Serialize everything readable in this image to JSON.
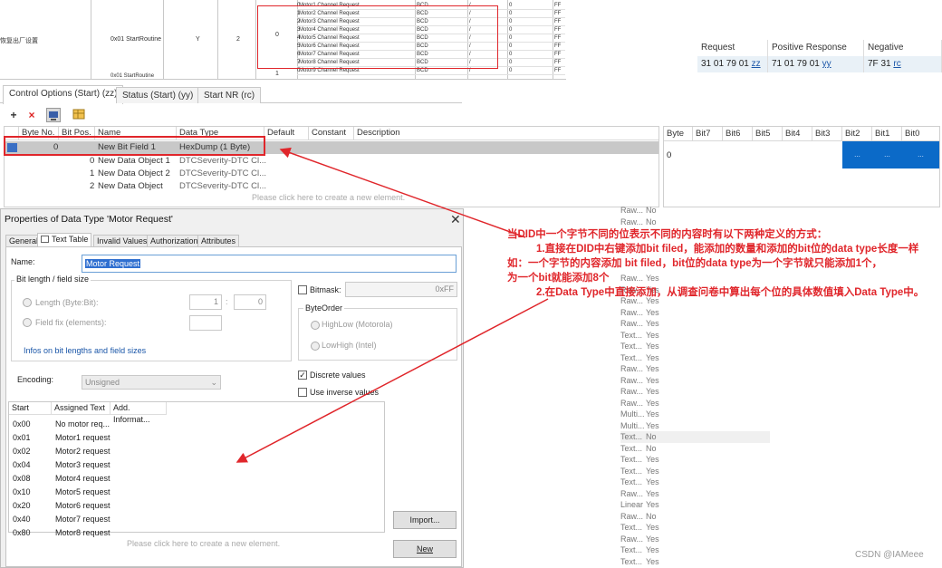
{
  "excel": {
    "row_label": "恢复出厂设置",
    "routine": "0x01 StartRoutine",
    "flag": "Y",
    "num": "2",
    "byte": "0",
    "rows": [
      {
        "bit": "0",
        "name": "Motor1 Channel Request",
        "enc": "BCD",
        "sep": "/",
        "v": "0",
        "ff": "FF"
      },
      {
        "bit": "1",
        "name": "Motor2 Channel Request",
        "enc": "BCD",
        "sep": "/",
        "v": "0",
        "ff": "FF"
      },
      {
        "bit": "2",
        "name": "Motor3 Channel Request",
        "enc": "BCD",
        "sep": "/",
        "v": "0",
        "ff": "FF"
      },
      {
        "bit": "3",
        "name": "Motor4 Channel Request",
        "enc": "BCD",
        "sep": "/",
        "v": "0",
        "ff": "FF"
      },
      {
        "bit": "4",
        "name": "Motor5 Channel Request",
        "enc": "BCD",
        "sep": "/",
        "v": "0",
        "ff": "FF"
      },
      {
        "bit": "5",
        "name": "Motor6 Channel Request",
        "enc": "BCD",
        "sep": "/",
        "v": "0",
        "ff": "FF"
      },
      {
        "bit": "6",
        "name": "Motor7 Channel Request",
        "enc": "BCD",
        "sep": "/",
        "v": "0",
        "ff": "FF"
      },
      {
        "bit": "7",
        "name": "Motor8 Channel Request",
        "enc": "BCD",
        "sep": "/",
        "v": "0",
        "ff": "FF"
      },
      {
        "bit": "0",
        "name": "Motor9 Channel Request",
        "enc": "BCD",
        "sep": "/",
        "v": "0",
        "ff": "FF"
      }
    ],
    "bottom_routine": "0x01 StartRoutine",
    "bottom_byte": "1"
  },
  "request_table": {
    "headers": [
      "Request",
      "Positive Response",
      "Negative Response"
    ],
    "values": [
      {
        "text": "31 01 79 01 ",
        "link": "zz"
      },
      {
        "text": "71 01 79 01 ",
        "link": "yy"
      },
      {
        "text": "7F 31 ",
        "link": "rc"
      }
    ]
  },
  "tabs": [
    "Control Options (Start) (zz)",
    "Status (Start) (yy)",
    "Start NR (rc)"
  ],
  "toolbar": {
    "add": "+",
    "delete": "×"
  },
  "grid": {
    "headers": [
      "Byte No.",
      "Bit Pos.",
      "Name",
      "Data Type",
      "Default",
      "Constant",
      "Description"
    ],
    "rows": [
      {
        "byte": "0",
        "bit": "",
        "name": "New Bit Field 1",
        "type": "HexDump (1 Byte)"
      },
      {
        "byte": "",
        "bit": "0",
        "name": "New Data Object 1",
        "type": "DTCSeverity-DTC Cl..."
      },
      {
        "byte": "",
        "bit": "1",
        "name": "New Data Object 2",
        "type": "DTCSeverity-DTC Cl..."
      },
      {
        "byte": "",
        "bit": "2",
        "name": "New Data Object",
        "type": "DTCSeverity-DTC Cl..."
      }
    ],
    "hint": "Please click here to create a new element."
  },
  "bits": {
    "headers": [
      "Byte",
      "Bit7",
      "Bit6",
      "Bit5",
      "Bit4",
      "Bit3",
      "Bit2",
      "Bit1",
      "Bit0"
    ],
    "byte_value": "0",
    "ellipsis": "..."
  },
  "dialog": {
    "title": "Properties of Data Type 'Motor Request'",
    "close": "✕",
    "tabs": [
      "General",
      "Text Table",
      "Invalid Values",
      "Authorization",
      "Attributes"
    ],
    "name_label": "Name:",
    "name_value": "Motor Request",
    "bitlen_group": "Bit length / field size",
    "length_label": "Length (Byte:Bit):",
    "length_byte": "1",
    "length_bit": "0",
    "colon": ":",
    "fieldfix_label": "Field fix (elements):",
    "infos_link": "Infos on bit lengths and field sizes",
    "encoding_label": "Encoding:",
    "encoding_value": "Unsigned",
    "bitmask_label": "Bitmask:",
    "bitmask_value": "0xFF",
    "byteorder_group": "ByteOrder",
    "highlow": "HighLow (Motorola)",
    "lowhigh": "LowHigh (Intel)",
    "discrete": "Discrete values",
    "inverse": "Use inverse values",
    "table_headers": [
      "Start",
      "Assigned Text",
      "Add. Informat..."
    ],
    "table_rows": [
      {
        "start": "0x00",
        "text": "No motor req..."
      },
      {
        "start": "0x01",
        "text": "Motor1 request"
      },
      {
        "start": "0x02",
        "text": "Motor2 request"
      },
      {
        "start": "0x04",
        "text": "Motor3 request"
      },
      {
        "start": "0x08",
        "text": "Motor4 request"
      },
      {
        "start": "0x10",
        "text": "Motor5 request"
      },
      {
        "start": "0x20",
        "text": "Motor6 request"
      },
      {
        "start": "0x40",
        "text": "Motor7 request"
      },
      {
        "start": "0x80",
        "text": "Motor8 request"
      }
    ],
    "table_hint": "Please click here to create a new element.",
    "import_btn": "Import...",
    "new_btn": "New"
  },
  "right_column": [
    {
      "a": "Raw...",
      "b": "No"
    },
    {
      "a": "Raw...",
      "b": "No"
    },
    {
      "a": "",
      "b": ""
    },
    {
      "a": "",
      "b": ""
    },
    {
      "a": "",
      "b": ""
    },
    {
      "a": "",
      "b": ""
    },
    {
      "a": "Raw...",
      "b": "Yes"
    },
    {
      "a": "Raw...",
      "b": "Yes"
    },
    {
      "a": "Raw...",
      "b": "Yes"
    },
    {
      "a": "Raw...",
      "b": "Yes"
    },
    {
      "a": "Raw...",
      "b": "Yes"
    },
    {
      "a": "Text...",
      "b": "Yes"
    },
    {
      "a": "Text...",
      "b": "Yes"
    },
    {
      "a": "Text...",
      "b": "Yes"
    },
    {
      "a": "Raw...",
      "b": "Yes"
    },
    {
      "a": "Raw...",
      "b": "Yes"
    },
    {
      "a": "Raw...",
      "b": "Yes"
    },
    {
      "a": "Raw...",
      "b": "Yes"
    },
    {
      "a": "Multi...",
      "b": "Yes"
    },
    {
      "a": "Multi...",
      "b": "Yes"
    },
    {
      "a": "Text...",
      "b": "No"
    },
    {
      "a": "Text...",
      "b": "No"
    },
    {
      "a": "Text...",
      "b": "Yes"
    },
    {
      "a": "Text...",
      "b": "Yes"
    },
    {
      "a": "Text...",
      "b": "Yes"
    },
    {
      "a": "Raw...",
      "b": "Yes"
    },
    {
      "a": "Linear",
      "b": "Yes"
    },
    {
      "a": "Raw...",
      "b": "No"
    },
    {
      "a": "Text...",
      "b": "Yes"
    },
    {
      "a": "Raw...",
      "b": "Yes"
    },
    {
      "a": "Text...",
      "b": "Yes"
    },
    {
      "a": "Text...",
      "b": "Yes"
    }
  ],
  "annotation": {
    "line1": "当DID中一个字节不同的位表示不同的内容时有以下两种定义的方式：",
    "line2": "1.直接在DID中右键添加bit filed，能添加的数量和添加的bit位的data type长度一样",
    "line3": "如：一个字节的内容添加 bit filed，bit位的data type为一个字节就只能添加1个，",
    "line4": "为一个bit就能添加8个",
    "line5": "2.在Data Type中直接添加，从调查问卷中算出每个位的具体数值填入Data Type中。"
  },
  "watermark": "CSDN @IAMeee",
  "colors": {
    "red": "#e0262b",
    "selection_blue": "#0b6ac8",
    "link": "#1a56a8"
  }
}
